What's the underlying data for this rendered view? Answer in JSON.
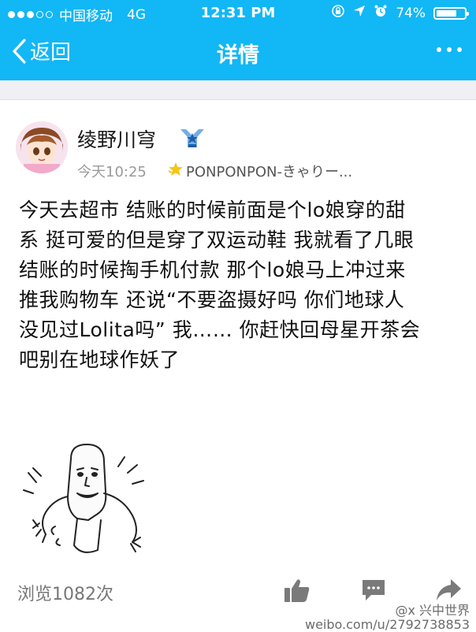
{
  "status_bar": {
    "carrier": "中国移动",
    "network": "4G",
    "time": "12:31 PM",
    "battery": "74%",
    "battery_level": 0.74
  },
  "nav": {
    "back_label": "返回",
    "title": "详情"
  },
  "post": {
    "user_name": "绫野川穹",
    "time": "今天10:25",
    "source": "PONPONPON-きゃりー...",
    "text_lines": [
      "今天去超市 结账的时候前面是个lo娘穿的甜",
      "系 挺可爱的但是穿了双运动鞋 我就看了几眼",
      "结账的时候掏手机付款 那个lo娘马上冲过来",
      "推我购物车 还说“不要盗摄好吗 你们地球人",
      "没见过Lolita吗” 我…… 你赶快回母星开茶会",
      "吧别在地球作妖了"
    ],
    "views": "浏览1082次"
  },
  "watermark": {
    "line1": "@x 兴中世界",
    "line2": "weibo.com/u/2792738853"
  },
  "colors": {
    "accent": "#12b7f5",
    "background": "#ffffff",
    "divider_band": "#efeff4"
  }
}
